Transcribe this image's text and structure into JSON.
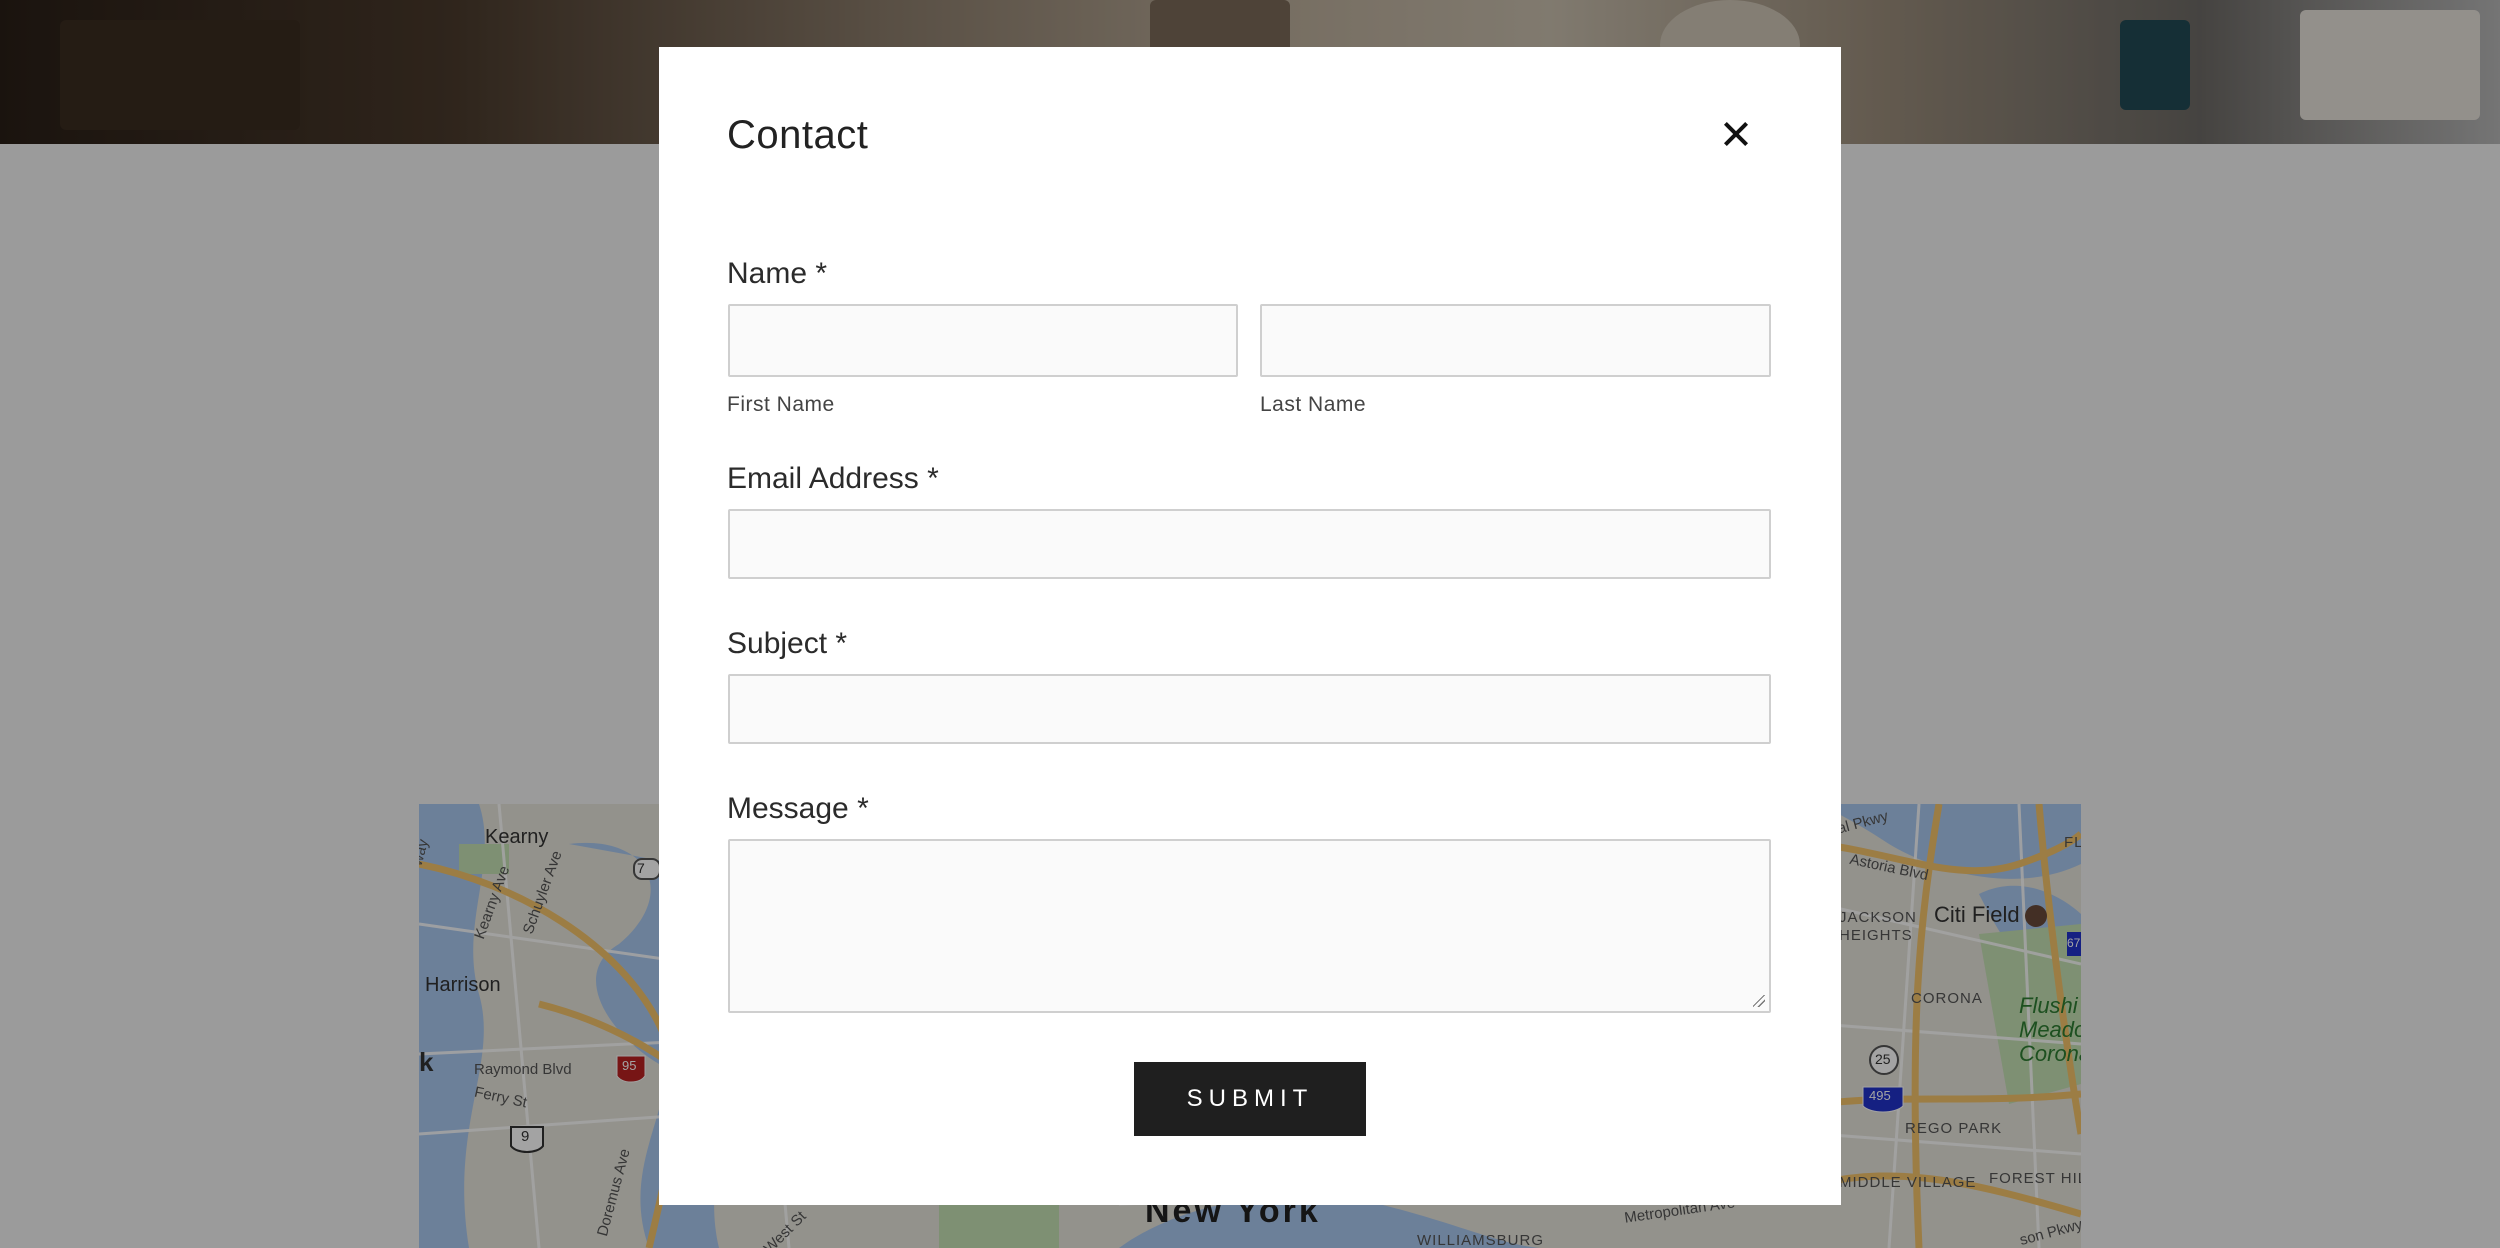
{
  "modal": {
    "title": "Contact",
    "close_icon": "close-icon"
  },
  "form": {
    "name_label": "Name *",
    "first_name_sublabel": "First Name",
    "last_name_sublabel": "Last Name",
    "first_name_value": "",
    "last_name_value": "",
    "email_label": "Email Address *",
    "email_value": "",
    "subject_label": "Subject *",
    "subject_value": "",
    "message_label": "Message *",
    "message_value": "",
    "submit_label": "SUBMIT"
  },
  "map": {
    "labels": {
      "kearny": "Kearny",
      "harrison": "Harrison",
      "k": "k",
      "raymond_blvd": "Raymond Blvd",
      "ferry_st": "Ferry St",
      "kearny_ave": "Kearny Ave",
      "schuyler_ave": "Schuyler Ave",
      "doremus_ave": "Doremus Ave",
      "west_st": "West St",
      "new_york": "New York",
      "williamsburg": "WILLIAMSBURG",
      "metropolitan_ave": "Metropolitan Ave",
      "citi_field": "Citi Field",
      "astoria_blvd": "Astoria Blvd",
      "jackson_heights": "JACKSON\nHEIGHTS",
      "corona": "CORONA",
      "flushing_meadows": "Flushi\nMeado\nCorona",
      "rego_park": "REGO PARK",
      "middle_village": "MIDDLE VILLAGE",
      "forest_hill": "FOREST HILL",
      "pkwy_top": "al Pkwy",
      "pkwy_bottom": "son Pkwy",
      "fl": "FL",
      "route_7": "7",
      "route_95": "95",
      "route_9": "9",
      "route_25": "25",
      "route_495": "495",
      "route_678": "67",
      "way": "way"
    }
  }
}
